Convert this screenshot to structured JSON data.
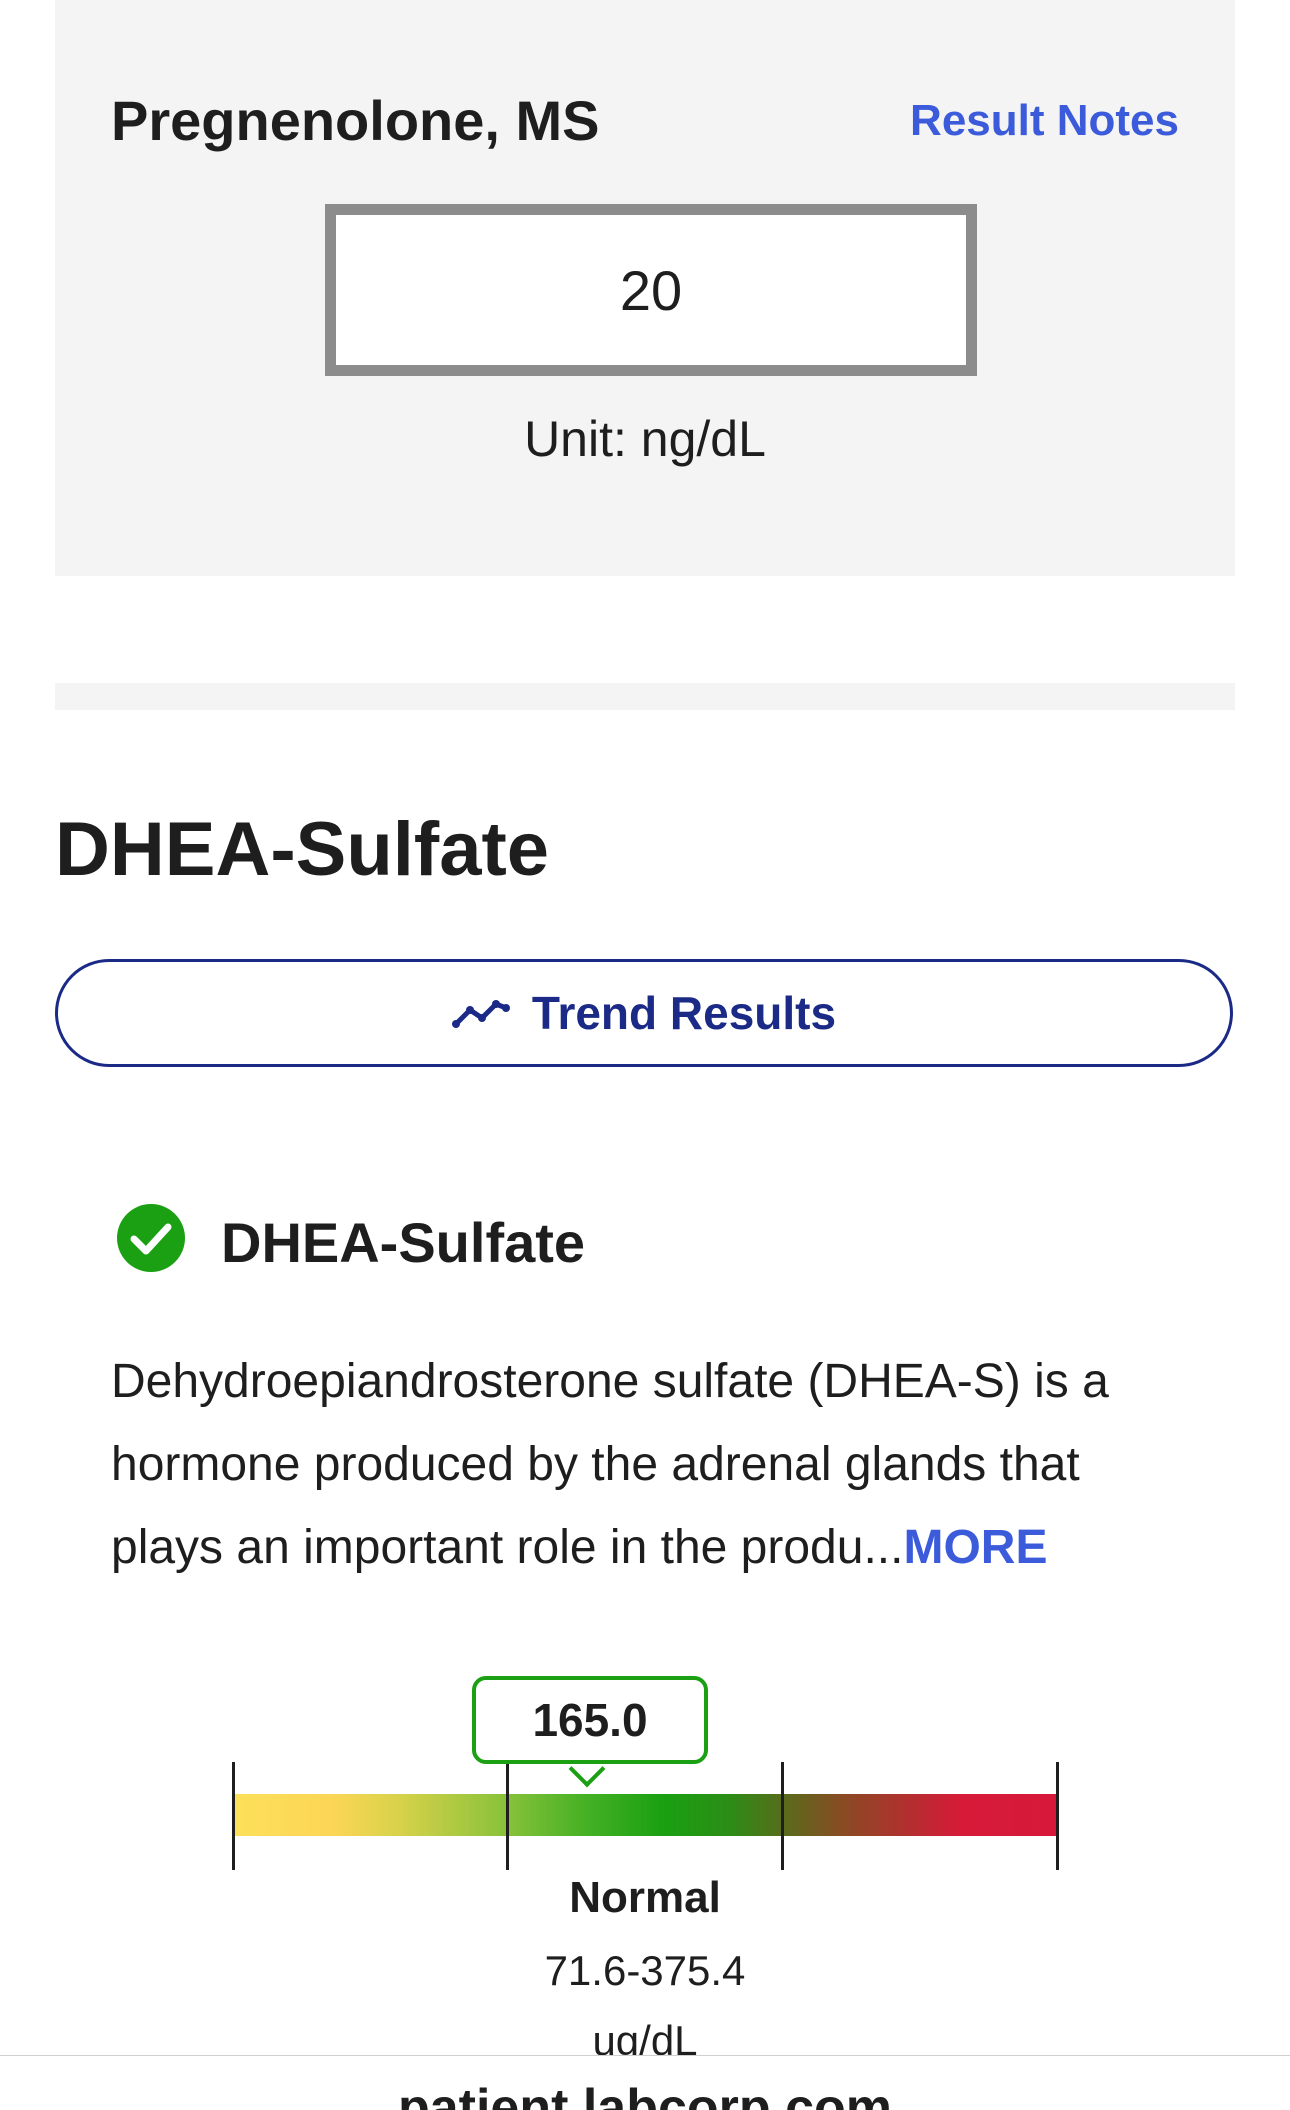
{
  "pregnenolone": {
    "title": "Pregnenolone, MS",
    "notes_link": "Result Notes",
    "value": "20",
    "unit": "Unit: ng/dL"
  },
  "dhea": {
    "section_title": "DHEA-Sulfate",
    "trend_button": "Trend Results",
    "test_name": "DHEA-Sulfate",
    "status_icon": "check-circle-icon",
    "description": "Dehydroepiandrosterone sulfate (DHEA-S) is a hormone produced by the adrenal glands that plays an important role in the produ...",
    "more_link": "MORE",
    "result_value": "165.0",
    "range_label": "Normal",
    "range_values": "71.6-375.4",
    "range_unit": "ug/dL",
    "colors": {
      "status": "#1aa012",
      "link": "#3b5bdb",
      "button": "#1a2a86"
    }
  },
  "footer": {
    "url": "patient.labcorp.com"
  }
}
